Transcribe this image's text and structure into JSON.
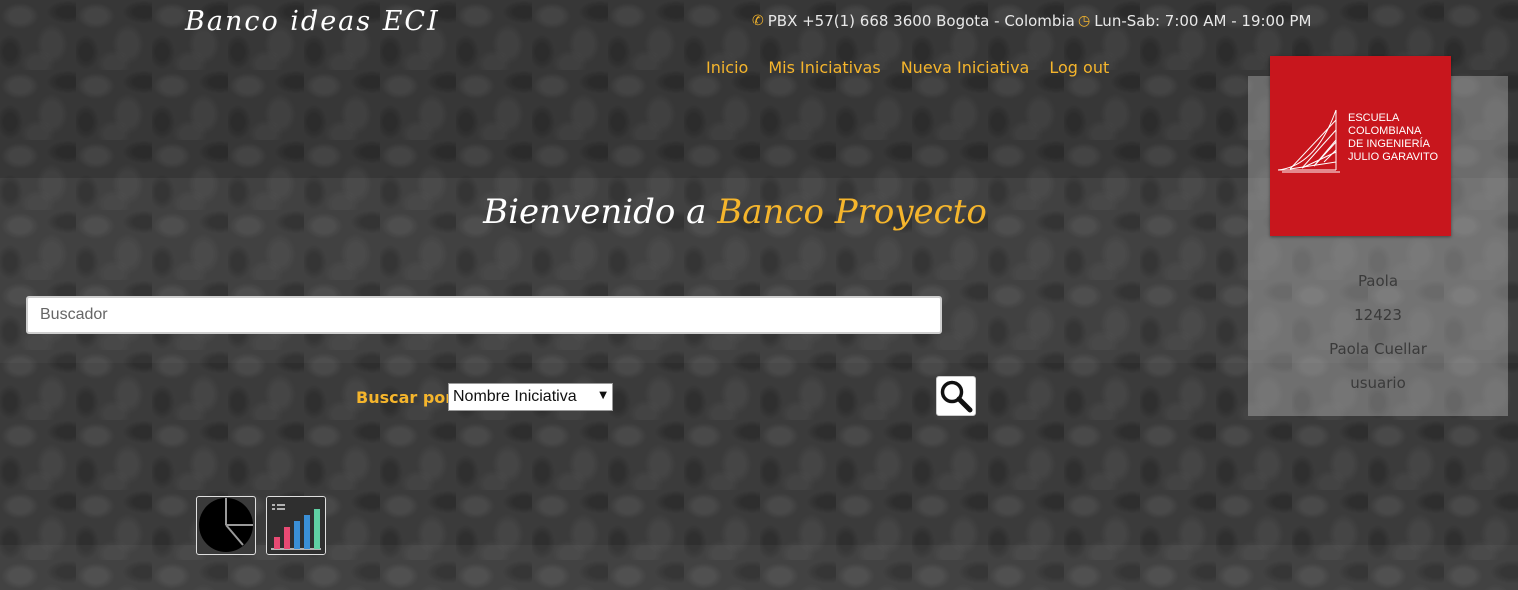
{
  "header": {
    "brand": "Banco ideas ECI",
    "phone_icon": "phone-icon",
    "phone": "PBX +57(1) 668 3600 Bogota - Colombia",
    "hours_icon": "clock-icon",
    "hours": "Lun-Sab: 7:00 AM - 19:00 PM"
  },
  "nav": {
    "items": [
      "Inicio",
      "Mis Iniciativas",
      "Nueva Iniciativa",
      "Log out"
    ]
  },
  "logo": {
    "lines": [
      "Escuela",
      "Colombiana",
      "de Ingeniería",
      "Julio Garavito"
    ],
    "color": "#c8161d"
  },
  "user": {
    "first_name": "Paola",
    "id": "12423",
    "full_name": "Paola Cuellar",
    "role": "usuario"
  },
  "welcome": {
    "prefix": "Bienvenido a ",
    "highlight": "Banco Proyecto"
  },
  "search": {
    "placeholder": "Buscador",
    "value": "",
    "filter_label": "Buscar por:",
    "filter_selected": "Nombre Iniciativa",
    "button_icon": "magnifier-icon"
  },
  "shortcuts": {
    "pie_icon": "pie-chart-icon",
    "bar_icon": "bar-chart-icon"
  },
  "colors": {
    "accent": "#f5b52c",
    "brand_red": "#c8161d"
  }
}
